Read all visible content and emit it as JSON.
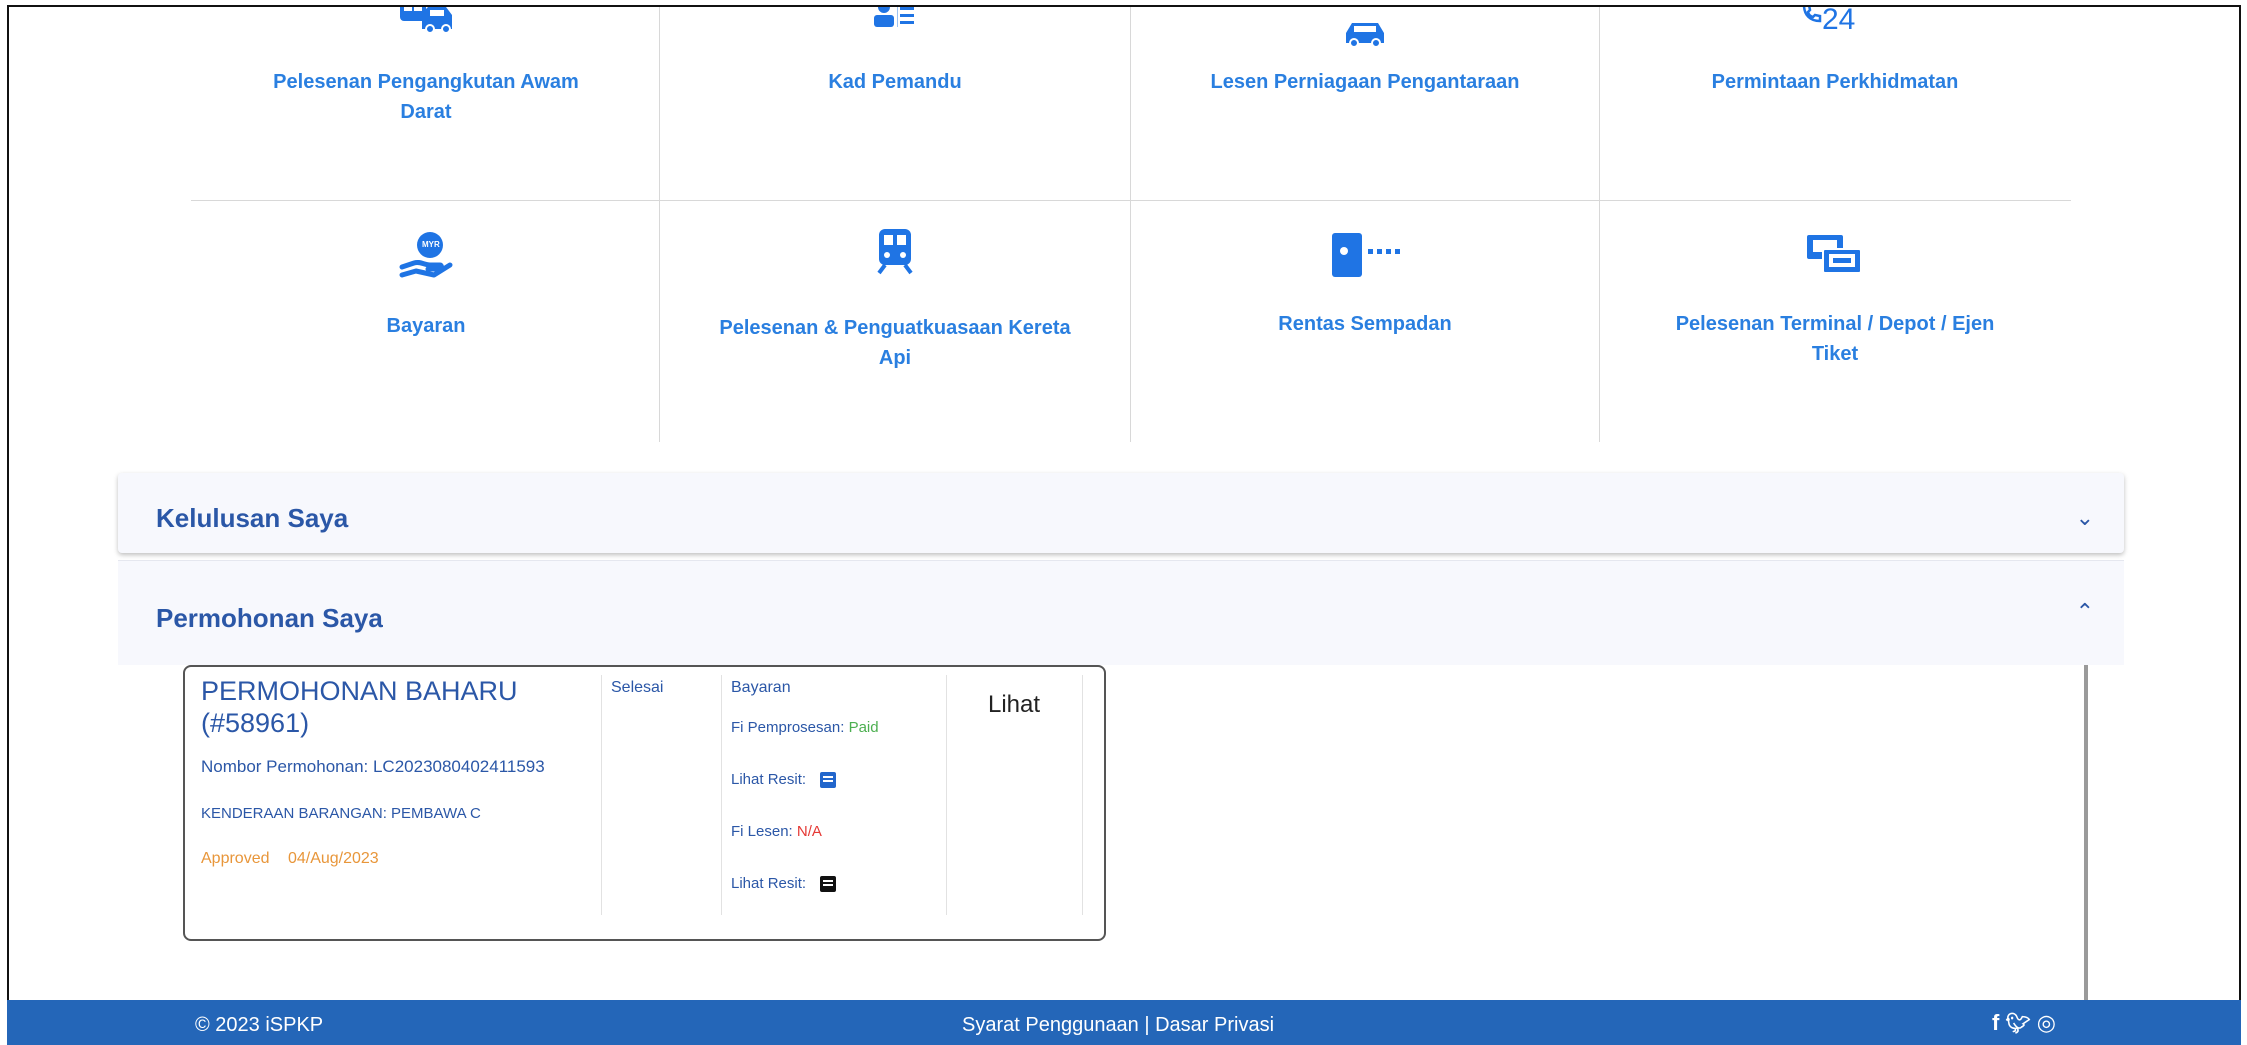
{
  "services": [
    {
      "label": "Pelesenan Pengangkutan Awam Darat",
      "icon": "bus-car-icon"
    },
    {
      "label": "Kad Pemandu",
      "icon": "driver-card-icon"
    },
    {
      "label": "Lesen Perniagaan Pengantaraan",
      "icon": "car-icon"
    },
    {
      "label": "Permintaan Perkhidmatan",
      "icon": "phone-24-icon",
      "icon_text": "24"
    },
    {
      "label": "Bayaran",
      "icon": "payment-hand-icon",
      "icon_text": "MYR"
    },
    {
      "label": "Pelesenan & Penguatkuasaan Kereta Api",
      "icon": "train-icon"
    },
    {
      "label": "Rentas Sempadan",
      "icon": "border-crossing-icon"
    },
    {
      "label": "Pelesenan Terminal / Depot / Ejen Tiket",
      "icon": "terminal-tickets-icon"
    }
  ],
  "accordion": {
    "kelulusan_title": "Kelulusan Saya",
    "permohonan_title": "Permohonan Saya",
    "chevron_down": "⌄",
    "chevron_up": "⌃"
  },
  "application": {
    "title": "PERMOHONAN BAHARU (#58961)",
    "number_label": "Nombor Permohonan: LC2023080402411593",
    "category": "KENDERAAN BARANGAN: PEMBAWA C",
    "status": "Approved",
    "date": "04/Aug/2023",
    "stage": "Selesai",
    "payment_header": "Bayaran",
    "fee_processing_label": "Fi Pemprosesan:",
    "fee_processing_value": "Paid",
    "receipt_label": "Lihat Resit:",
    "fee_license_label": "Fi Lesen:",
    "fee_license_value": "N/A",
    "view_label": "Lihat"
  },
  "footer": {
    "copyright": "© 2023 iSPKP",
    "links": "Syarat Penggunaan | Dasar Privasi",
    "social": "f  ◎"
  },
  "colors": {
    "accent": "#1f74e4",
    "heading": "#2b57a7",
    "footer_bg": "#2466b8",
    "status_approved": "#e8963a",
    "paid": "#4caf50",
    "na": "#e53935"
  }
}
